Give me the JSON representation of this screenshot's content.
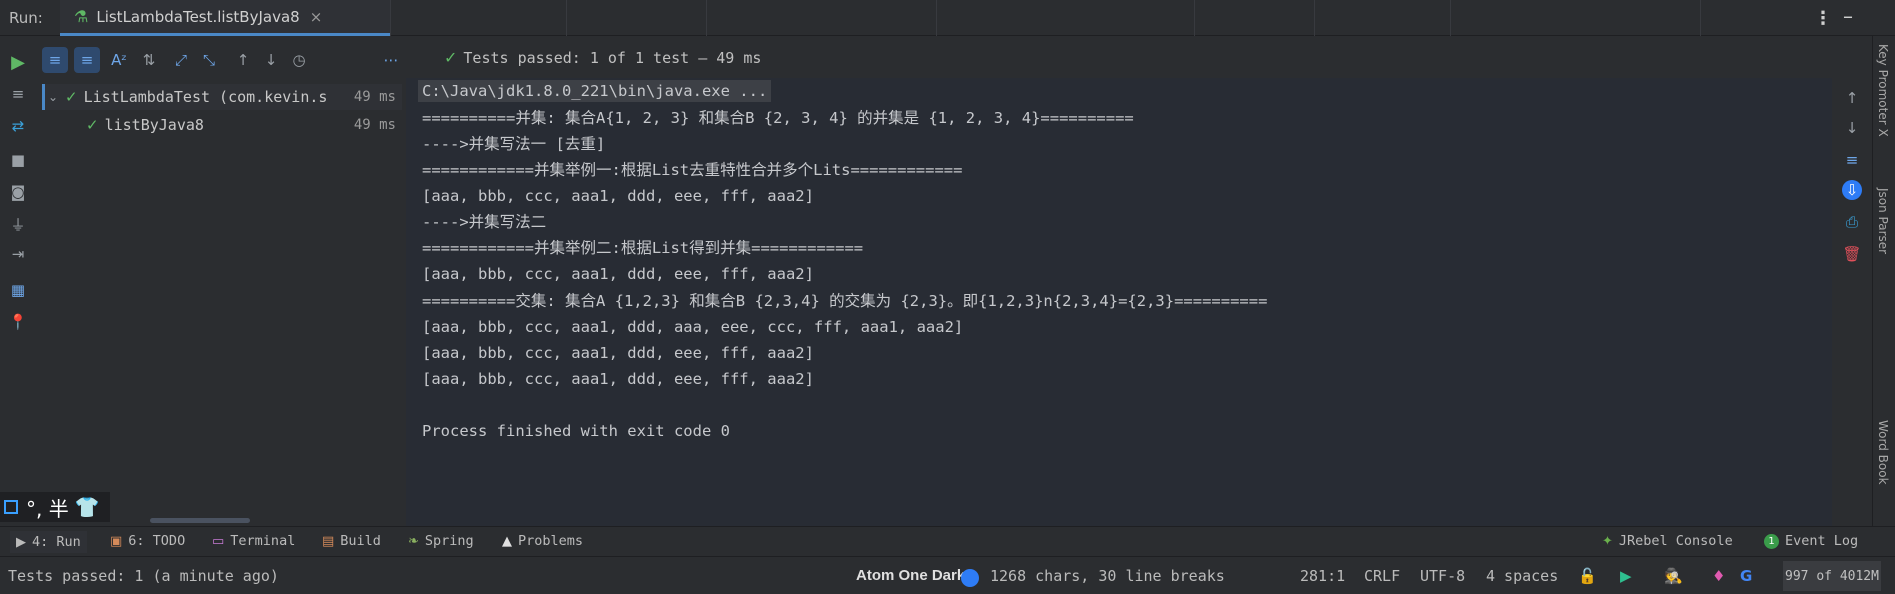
{
  "top_bar": {
    "run_label": "Run:",
    "tab_title": "ListLambdaTest.listByJava8",
    "tab_close": "×",
    "menu_glyph": "⋮",
    "minimize_glyph": "–"
  },
  "toolbar": {
    "status_text": "Tests passed: 1 of 1 test – 49 ms",
    "more_glyph": "⋯"
  },
  "tree": {
    "items": [
      {
        "name": "ListLambdaTest (com.kevin.s",
        "time": "49 ms",
        "expanded": true
      },
      {
        "name": "listByJava8",
        "time": "49 ms"
      }
    ]
  },
  "console": {
    "command": "C:\\Java\\jdk1.8.0_221\\bin\\java.exe ...",
    "lines": [
      "==========并集: 集合A{1, 2, 3} 和集合B {2, 3, 4} 的并集是 {1, 2, 3, 4}==========",
      "---->并集写法一 [去重]",
      "============并集举例一:根据List去重特性合并多个Lits============",
      "[aaa, bbb, ccc, aaa1, ddd, eee, fff, aaa2]",
      "---->并集写法二",
      "============并集举例二:根据List得到并集============",
      "[aaa, bbb, ccc, aaa1, ddd, eee, fff, aaa2]",
      "==========交集: 集合A {1,2,3} 和集合B {2,3,4} 的交集为 {2,3}。即{1,2,3}n{2,3,4}={2,3}==========",
      "[aaa, bbb, ccc, aaa1, ddd, aaa, eee, ccc, fff, aaa1, aaa2]",
      "[aaa, bbb, ccc, aaa1, ddd, eee, fff, aaa2]",
      "[aaa, bbb, ccc, aaa1, ddd, eee, fff, aaa2]",
      "",
      "Process finished with exit code 0"
    ]
  },
  "right_sidebar": {
    "key_promoter": "Key Promoter X",
    "json_parser": "Json Parser",
    "word_book": "Word Book"
  },
  "ime": {
    "text": "°, 半"
  },
  "bottom_tools": {
    "run": "4: Run",
    "todo": "6: TODO",
    "terminal": "Terminal",
    "build": "Build",
    "spring": "Spring",
    "problems": "Problems",
    "jrebel": "JRebel Console",
    "event_log": "Event Log",
    "event_log_count": "1"
  },
  "status_bar": {
    "message": "Tests passed: 1 (a minute ago)",
    "theme": "Atom One Dark",
    "chars": "1268 chars, 30 line breaks",
    "position": "281:1",
    "line_sep": "CRLF",
    "encoding": "UTF-8",
    "indent": "4 spaces",
    "memory": "997 of 4012M"
  },
  "colors": {
    "accent": "#4a88c7",
    "pass_green": "#5fb865",
    "console_bg": "#282c34",
    "ide_bg": "#2b2d30"
  }
}
